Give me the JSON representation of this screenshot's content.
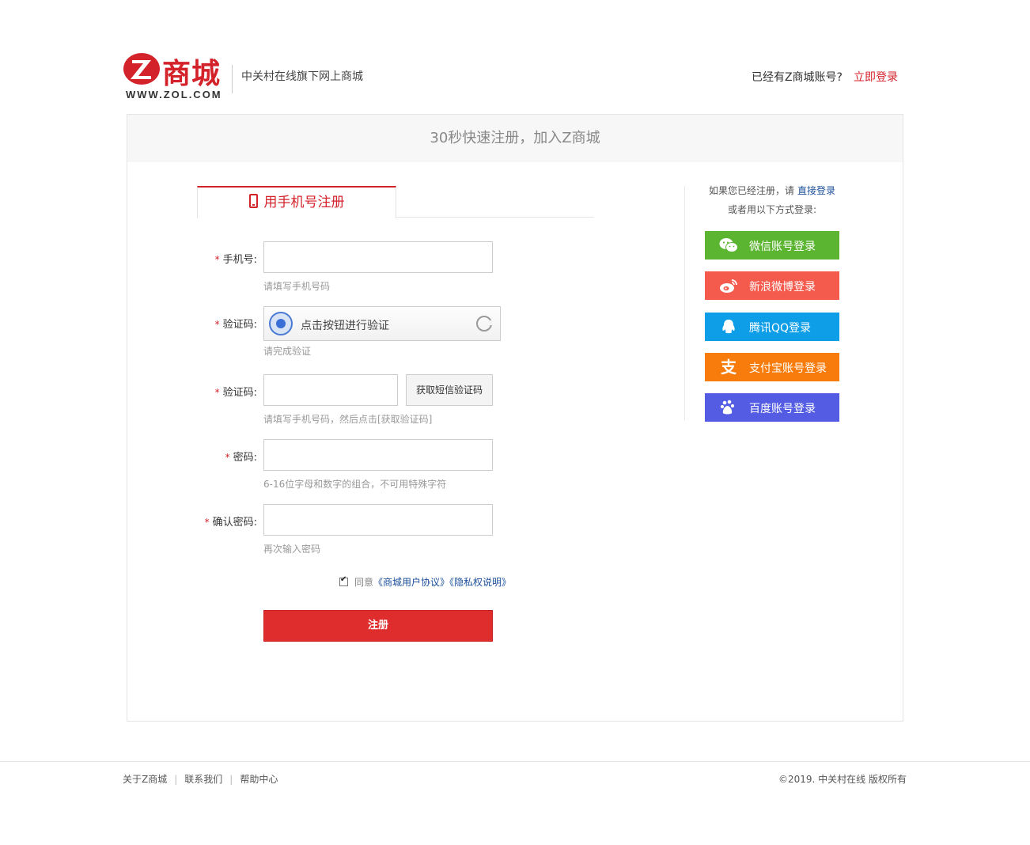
{
  "header": {
    "logo_text": "商城",
    "logo_url": "WWW.ZOL.COM",
    "slogan": "中关村在线旗下网上商城",
    "login_prompt": "已经有Z商城账号?",
    "login_link": "立即登录"
  },
  "main": {
    "title": "30秒快速注册，加入Z商城",
    "tab_label": "用手机号注册",
    "fields": {
      "phone": {
        "label": "手机号:",
        "tip": "请填写手机号码",
        "value": ""
      },
      "captcha": {
        "label": "验证码:",
        "button_text": "点击按钮进行验证",
        "tip": "请完成验证"
      },
      "sms": {
        "label": "验证码:",
        "button": "获取短信验证码",
        "tip": "请填写手机号码，然后点击[获取验证码]",
        "value": ""
      },
      "password": {
        "label": "密码:",
        "tip": "6-16位字母和数字的组合，不可用特殊字符",
        "value": ""
      },
      "confirm": {
        "label": "确认密码:",
        "tip": "再次输入密码",
        "value": ""
      }
    },
    "agree": {
      "prefix": "同意",
      "agreement": "《商城用户协议》",
      "privacy": "《隐私权说明》"
    },
    "submit": "注册"
  },
  "side": {
    "line1_prefix": "如果您已经注册，请",
    "line1_link": "直接登录",
    "line2": "或者用以下方式登录:",
    "sso": [
      {
        "label": "微信账号登录",
        "color": "#5cb531",
        "icon": "wechat-icon"
      },
      {
        "label": "新浪微博登录",
        "color": "#f45b4d",
        "icon": "weibo-icon"
      },
      {
        "label": "腾讯QQ登录",
        "color": "#0e9ee8",
        "icon": "qq-icon"
      },
      {
        "label": "支付宝账号登录",
        "color": "#f87c0b",
        "icon": "alipay-icon"
      },
      {
        "label": "百度账号登录",
        "color": "#535ce3",
        "icon": "baidu-icon"
      }
    ]
  },
  "footer": {
    "links": [
      "关于Z商城",
      "联系我们",
      "帮助中心"
    ],
    "copyright": "©2019. 中关村在线 版权所有"
  }
}
